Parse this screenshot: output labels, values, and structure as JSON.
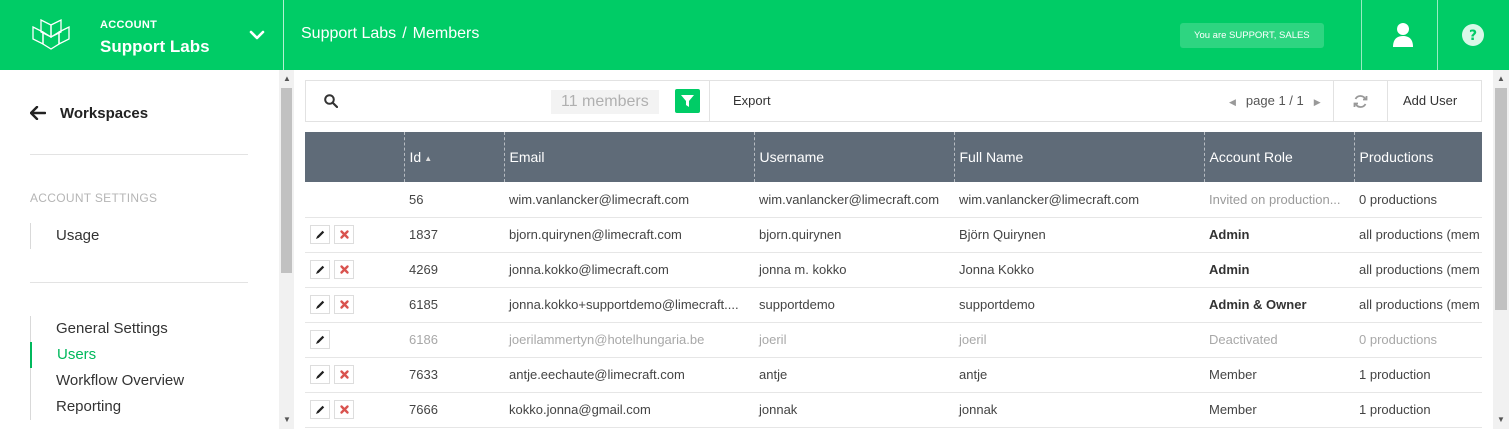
{
  "header": {
    "account_label": "ACCOUNT",
    "account_name": "Support Labs",
    "breadcrumb": [
      "Support Labs",
      "Members"
    ],
    "breadcrumb_sep": "/",
    "role_badge": "You are SUPPORT, SALES",
    "brand_color": "#00cc66"
  },
  "sidebar": {
    "back_label": "Workspaces",
    "section_title": "ACCOUNT SETTINGS",
    "usage_label": "Usage",
    "items": [
      {
        "label": "General Settings",
        "active": false
      },
      {
        "label": "Users",
        "active": true
      },
      {
        "label": "Workflow Overview",
        "active": false
      },
      {
        "label": "Reporting",
        "active": false
      }
    ]
  },
  "toolbar": {
    "member_count": "11 members",
    "export_label": "Export",
    "page_label": "page 1 / 1",
    "add_user_label": "Add User"
  },
  "table": {
    "columns": [
      "",
      "Id",
      "Email",
      "Username",
      "Full Name",
      "Account Role",
      "Productions"
    ],
    "sorted_column": "Id",
    "rows": [
      {
        "edit": false,
        "delete": false,
        "dim": false,
        "id": "56",
        "email": "wim.vanlancker@limecraft.com",
        "username": "wim.vanlancker@limecraft.com",
        "full_name": "wim.vanlancker@limecraft.com",
        "role": "Invited on production...",
        "role_style": "muted",
        "productions": "0 productions"
      },
      {
        "edit": true,
        "delete": true,
        "dim": false,
        "id": "1837",
        "email": "bjorn.quirynen@limecraft.com",
        "username": "bjorn.quirynen",
        "full_name": "Björn Quirynen",
        "role": "Admin",
        "role_style": "bold",
        "productions": "all productions (mem"
      },
      {
        "edit": true,
        "delete": true,
        "dim": false,
        "id": "4269",
        "email": "jonna.kokko@limecraft.com",
        "username": "jonna m. kokko",
        "full_name": "Jonna Kokko",
        "role": "Admin",
        "role_style": "bold",
        "productions": "all productions (mem"
      },
      {
        "edit": true,
        "delete": true,
        "dim": false,
        "id": "6185",
        "email": "jonna.kokko+supportdemo@limecraft....",
        "username": "supportdemo",
        "full_name": "supportdemo",
        "role": "Admin & Owner",
        "role_style": "bold",
        "productions": "all productions (mem"
      },
      {
        "edit": true,
        "delete": false,
        "dim": true,
        "id": "6186",
        "email": "joerilammertyn@hotelhungaria.be",
        "username": "joeril",
        "full_name": "joeril",
        "role": "Deactivated",
        "role_style": "normal",
        "productions": "0 productions"
      },
      {
        "edit": true,
        "delete": true,
        "dim": false,
        "id": "7633",
        "email": "antje.eechaute@limecraft.com",
        "username": "antje",
        "full_name": "antje",
        "role": "Member",
        "role_style": "normal",
        "productions": "1 production"
      },
      {
        "edit": true,
        "delete": true,
        "dim": false,
        "id": "7666",
        "email": "kokko.jonna@gmail.com",
        "username": "jonnak",
        "full_name": "jonnak",
        "role": "Member",
        "role_style": "normal",
        "productions": "1 production"
      }
    ]
  }
}
